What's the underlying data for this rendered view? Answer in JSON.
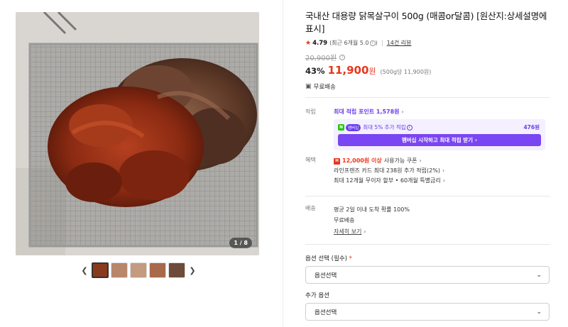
{
  "gallery": {
    "page_indicator": "1 / 8",
    "prev_icon": "chevron-left-icon",
    "next_icon": "chevron-right-icon",
    "thumbnail_count": 5,
    "active_thumbnail": 1
  },
  "product": {
    "title": "국내산 대용량 닭목살구이 500g (매콤or달콤) [원산지:상세설명에 표시]",
    "rating": "4.79",
    "rating_detail": "(최근 6개월 5.0",
    "rating_close": ")",
    "review_count": "14건 리뷰",
    "original_price": "20,900원",
    "discount": "43%",
    "price": "11,900",
    "price_unit": "원",
    "unit_price": "(500g당 11,900원)",
    "shipping": "무료배송"
  },
  "points": {
    "label": "적립",
    "max_points": "최대 적립 포인트 1,578원",
    "npay_badge": "N",
    "member_badge": "멤버십",
    "extra_text": "최대 5% 추가 적립",
    "extra_amount": "476원",
    "membership_button": "멤버십 시작하고 최대 적립 받기"
  },
  "benefits": {
    "label": "혜택",
    "coupon_badge": "H",
    "coupon_amount": "12,000원 이상",
    "coupon_text": "사용가능 쿠폰",
    "card_text": "라인프렌즈 카드 최대 238원 추가 적립(2%)",
    "installment_text": "최대 12개월 무이자 할부 • 60개월 특별금리"
  },
  "delivery": {
    "label": "배송",
    "line1": "평균 2일 이내 도착 확률 100%",
    "line2": "무료배송",
    "detail_link": "자세히 보기"
  },
  "options": {
    "required_label": "옵션 선택 (필수)",
    "required_mark": "*",
    "required_value": "옵션선택",
    "additional_label": "추가 옵션",
    "additional_value": "옵션선택"
  },
  "colors": {
    "accent_red": "#e8361d",
    "membership_purple": "#7a45f2",
    "npay_green": "#1ec800"
  }
}
